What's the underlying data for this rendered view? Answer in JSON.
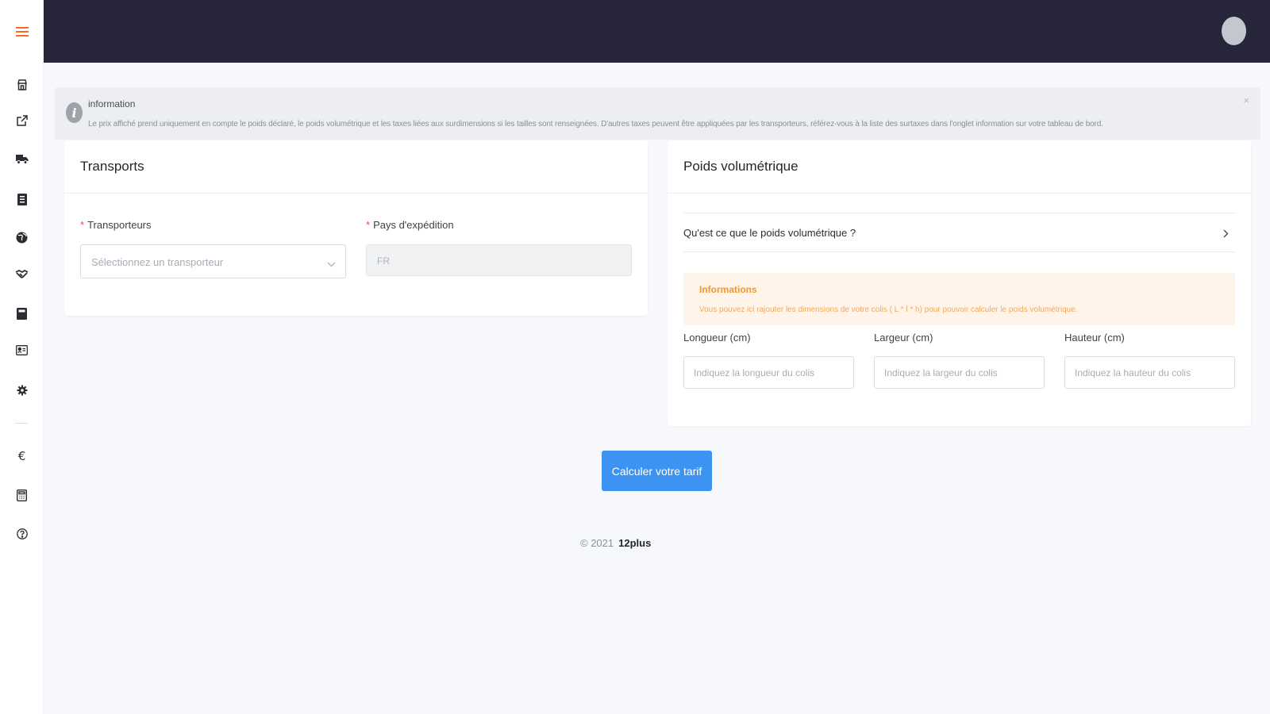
{
  "colors": {
    "header_bg": "#27253a",
    "accent": "#f26a22",
    "primary_button": "#3d93f2",
    "required_asterisk": "#f5454f",
    "warning_text": "#f0982e",
    "warning_bg": "#fff4e9"
  },
  "sidebar": {
    "items": [
      {
        "icon": "hamburger-menu-icon"
      },
      {
        "icon": "store-icon"
      },
      {
        "icon": "external-link-icon"
      },
      {
        "icon": "truck-icon"
      },
      {
        "icon": "document-icon"
      },
      {
        "icon": "globe-icon"
      },
      {
        "icon": "handshake-icon"
      },
      {
        "icon": "receipt-icon"
      },
      {
        "icon": "id-card-icon"
      },
      {
        "icon": "gear-icon"
      },
      {
        "icon": "euro-icon"
      },
      {
        "icon": "calculator-icon"
      },
      {
        "icon": "help-icon"
      }
    ]
  },
  "header": {
    "avatar_icon": "user-avatar"
  },
  "alert": {
    "title": "information",
    "message": "Le prix affiché prend uniquement en compte le poids déclaré, le poids volumétrique et les taxes liées aux surdimensions si les tailles sont renseignées. D'autres taxes peuvent être appliquées par les transporteurs, référez-vous à la liste des surtaxes dans l'onglet information sur votre tableau de bord.",
    "close": "×"
  },
  "transports": {
    "title": "Transports",
    "carrier_label": "Transporteurs",
    "carrier_placeholder": "Sélectionnez un transporteur",
    "country_label": "Pays d'expédition",
    "country_value": "FR",
    "required_mark": "*"
  },
  "poids": {
    "title": "Poids volumétrique",
    "collapse_label": "Qu'est ce que le poids volumétrique ?",
    "info_title": "Informations",
    "info_message": "Vous pouvez ici rajouter les dimensions de votre colis ( L * l * h) pour pouvoir calculer le poids volumétrique.",
    "length_label": "Longueur (cm)",
    "length_placeholder": "Indiquez la longueur du colis",
    "width_label": "Largeur (cm)",
    "width_placeholder": "Indiquez la largeur du colis",
    "height_label": "Hauteur (cm)",
    "height_placeholder": "Indiquez la hauteur du colis"
  },
  "actions": {
    "calculate": "Calculer votre tarif"
  },
  "footer": {
    "copyright": "© 2021",
    "brand": "12plus"
  }
}
